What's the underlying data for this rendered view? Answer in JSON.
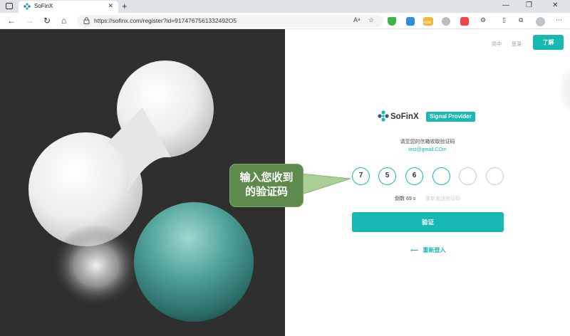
{
  "browser": {
    "tab_title": "SoFinX",
    "tab_close": "✕",
    "new_tab": "+",
    "url": "https://sofinx.com/register?id=9174767561332492O5",
    "nav": {
      "back": "←",
      "forward": "→",
      "reload": "↻",
      "home": "⌂"
    },
    "extension_badge": "+50k",
    "window_controls": {
      "minimize": "—",
      "restore": "❐",
      "close": "✕"
    }
  },
  "header": {
    "lang_link": "简中",
    "login_link": "登录",
    "cta_button": "了解"
  },
  "brand": {
    "name": "SoFinX",
    "badge": "Signal Provider",
    "accent_color": "#17b9b2"
  },
  "form": {
    "prompt": "请至您的信箱收取验证码",
    "email": "test@gmail.COm",
    "code_digits": [
      "7",
      "5",
      "6",
      "",
      "",
      ""
    ],
    "countdown": "倒数 69 s",
    "resend": "重新发送验证码",
    "submit_label": "验证",
    "back_arrow": "⟵",
    "back_label": "重新登入"
  },
  "annotation": {
    "line1": "输入您收到",
    "line2": "的验证码",
    "color": "#5f8a4e"
  }
}
